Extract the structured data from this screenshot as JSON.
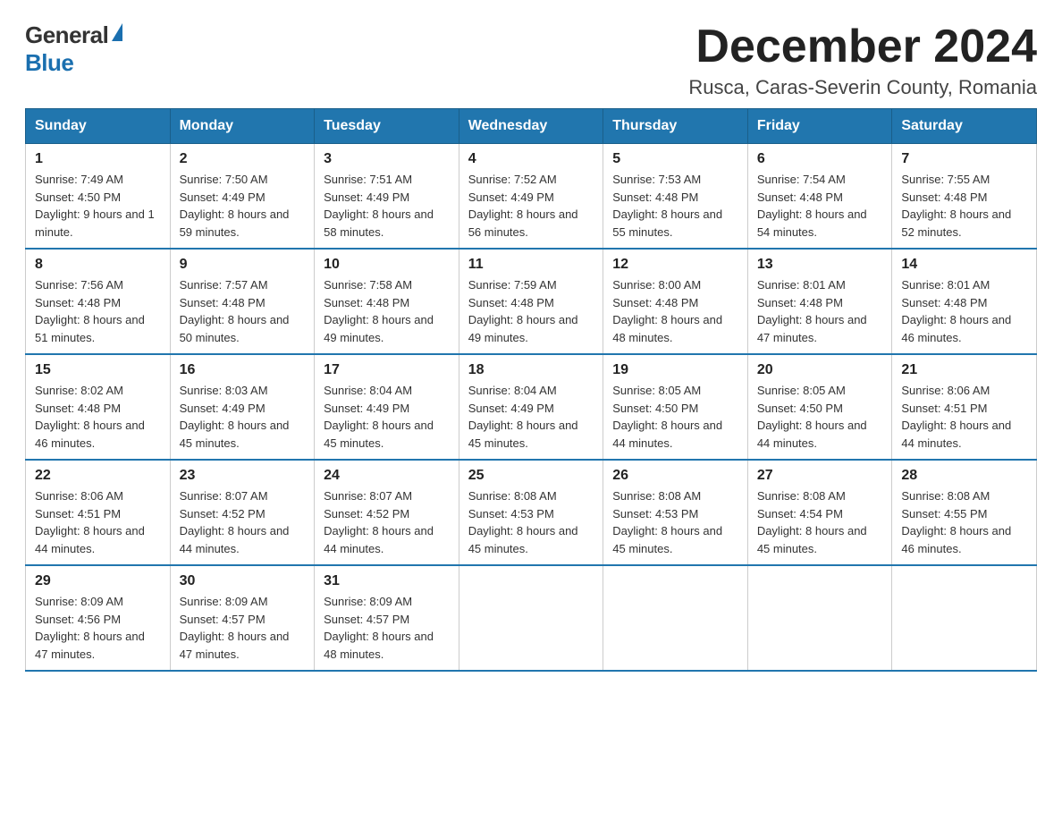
{
  "logo": {
    "general": "General",
    "blue": "Blue"
  },
  "header": {
    "month": "December 2024",
    "location": "Rusca, Caras-Severin County, Romania"
  },
  "days_of_week": [
    "Sunday",
    "Monday",
    "Tuesday",
    "Wednesday",
    "Thursday",
    "Friday",
    "Saturday"
  ],
  "weeks": [
    [
      {
        "day": "1",
        "sunrise": "7:49 AM",
        "sunset": "4:50 PM",
        "daylight": "9 hours and 1 minute."
      },
      {
        "day": "2",
        "sunrise": "7:50 AM",
        "sunset": "4:49 PM",
        "daylight": "8 hours and 59 minutes."
      },
      {
        "day": "3",
        "sunrise": "7:51 AM",
        "sunset": "4:49 PM",
        "daylight": "8 hours and 58 minutes."
      },
      {
        "day": "4",
        "sunrise": "7:52 AM",
        "sunset": "4:49 PM",
        "daylight": "8 hours and 56 minutes."
      },
      {
        "day": "5",
        "sunrise": "7:53 AM",
        "sunset": "4:48 PM",
        "daylight": "8 hours and 55 minutes."
      },
      {
        "day": "6",
        "sunrise": "7:54 AM",
        "sunset": "4:48 PM",
        "daylight": "8 hours and 54 minutes."
      },
      {
        "day": "7",
        "sunrise": "7:55 AM",
        "sunset": "4:48 PM",
        "daylight": "8 hours and 52 minutes."
      }
    ],
    [
      {
        "day": "8",
        "sunrise": "7:56 AM",
        "sunset": "4:48 PM",
        "daylight": "8 hours and 51 minutes."
      },
      {
        "day": "9",
        "sunrise": "7:57 AM",
        "sunset": "4:48 PM",
        "daylight": "8 hours and 50 minutes."
      },
      {
        "day": "10",
        "sunrise": "7:58 AM",
        "sunset": "4:48 PM",
        "daylight": "8 hours and 49 minutes."
      },
      {
        "day": "11",
        "sunrise": "7:59 AM",
        "sunset": "4:48 PM",
        "daylight": "8 hours and 49 minutes."
      },
      {
        "day": "12",
        "sunrise": "8:00 AM",
        "sunset": "4:48 PM",
        "daylight": "8 hours and 48 minutes."
      },
      {
        "day": "13",
        "sunrise": "8:01 AM",
        "sunset": "4:48 PM",
        "daylight": "8 hours and 47 minutes."
      },
      {
        "day": "14",
        "sunrise": "8:01 AM",
        "sunset": "4:48 PM",
        "daylight": "8 hours and 46 minutes."
      }
    ],
    [
      {
        "day": "15",
        "sunrise": "8:02 AM",
        "sunset": "4:48 PM",
        "daylight": "8 hours and 46 minutes."
      },
      {
        "day": "16",
        "sunrise": "8:03 AM",
        "sunset": "4:49 PM",
        "daylight": "8 hours and 45 minutes."
      },
      {
        "day": "17",
        "sunrise": "8:04 AM",
        "sunset": "4:49 PM",
        "daylight": "8 hours and 45 minutes."
      },
      {
        "day": "18",
        "sunrise": "8:04 AM",
        "sunset": "4:49 PM",
        "daylight": "8 hours and 45 minutes."
      },
      {
        "day": "19",
        "sunrise": "8:05 AM",
        "sunset": "4:50 PM",
        "daylight": "8 hours and 44 minutes."
      },
      {
        "day": "20",
        "sunrise": "8:05 AM",
        "sunset": "4:50 PM",
        "daylight": "8 hours and 44 minutes."
      },
      {
        "day": "21",
        "sunrise": "8:06 AM",
        "sunset": "4:51 PM",
        "daylight": "8 hours and 44 minutes."
      }
    ],
    [
      {
        "day": "22",
        "sunrise": "8:06 AM",
        "sunset": "4:51 PM",
        "daylight": "8 hours and 44 minutes."
      },
      {
        "day": "23",
        "sunrise": "8:07 AM",
        "sunset": "4:52 PM",
        "daylight": "8 hours and 44 minutes."
      },
      {
        "day": "24",
        "sunrise": "8:07 AM",
        "sunset": "4:52 PM",
        "daylight": "8 hours and 44 minutes."
      },
      {
        "day": "25",
        "sunrise": "8:08 AM",
        "sunset": "4:53 PM",
        "daylight": "8 hours and 45 minutes."
      },
      {
        "day": "26",
        "sunrise": "8:08 AM",
        "sunset": "4:53 PM",
        "daylight": "8 hours and 45 minutes."
      },
      {
        "day": "27",
        "sunrise": "8:08 AM",
        "sunset": "4:54 PM",
        "daylight": "8 hours and 45 minutes."
      },
      {
        "day": "28",
        "sunrise": "8:08 AM",
        "sunset": "4:55 PM",
        "daylight": "8 hours and 46 minutes."
      }
    ],
    [
      {
        "day": "29",
        "sunrise": "8:09 AM",
        "sunset": "4:56 PM",
        "daylight": "8 hours and 47 minutes."
      },
      {
        "day": "30",
        "sunrise": "8:09 AM",
        "sunset": "4:57 PM",
        "daylight": "8 hours and 47 minutes."
      },
      {
        "day": "31",
        "sunrise": "8:09 AM",
        "sunset": "4:57 PM",
        "daylight": "8 hours and 48 minutes."
      },
      null,
      null,
      null,
      null
    ]
  ]
}
